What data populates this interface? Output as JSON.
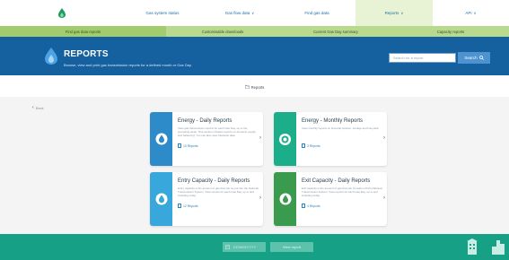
{
  "nav": {
    "items": [
      {
        "label": "Gas system status",
        "chev": ""
      },
      {
        "label": "Gas flow data",
        "chev": "∨"
      },
      {
        "label": "Find gas data",
        "chev": ""
      },
      {
        "label": "Reports",
        "chev": "∨"
      },
      {
        "label": "API",
        "chev": "∨"
      }
    ]
  },
  "subnav": {
    "items": [
      {
        "label": "Find gas data reports"
      },
      {
        "label": "Customisable downloads"
      },
      {
        "label": "Current Gas Day summary"
      },
      {
        "label": "Capacity reports"
      }
    ]
  },
  "hero": {
    "title": "REPORTS",
    "subtitle": "Browse, view and print gas transmission reports for a defined month or Gas Day.",
    "search_placeholder": "Search for a report",
    "search_button": "Search"
  },
  "breadcrumb": {
    "label": "Reports"
  },
  "back": {
    "label": "Back"
  },
  "cards": [
    {
      "title": "Energy - Daily Reports",
      "desc": "View gas transmission reports for each Gas Day, up to the preceding week. This section includes reports on demand, supply and balancing. You can also view historical data.",
      "count": "10 Reports",
      "icon_bg": "#2e8bc9"
    },
    {
      "title": "Energy - Monthly Reports",
      "desc": "View monthly reports on financial position, storage and line-pack.",
      "count": "3 Reports",
      "icon_bg": "#1cae8a"
    },
    {
      "title": "Entry Capacity - Daily Reports",
      "desc": "Entry capacity is the amount of gas that can be put into the National Transmission System. View reports for each Gas Day, up to and including today.",
      "count": "12 Reports",
      "icon_bg": "#37a7dc"
    },
    {
      "title": "Exit Capacity - Daily Reports",
      "desc": "Exit capacity is the amount of gas that can be taken off the National Transmission System. View reports for each Gas Day, up to and including today.",
      "count": "4 Reports",
      "icon_bg": "#3a9b4f"
    }
  ],
  "footer": {
    "date_label": "DD/MM/YYYY",
    "view_button": "View report"
  },
  "colors": {
    "nav_link": "#1d6fa5",
    "subnav": "#b9d98f",
    "hero": "#15609e",
    "footer": "#16a085"
  }
}
